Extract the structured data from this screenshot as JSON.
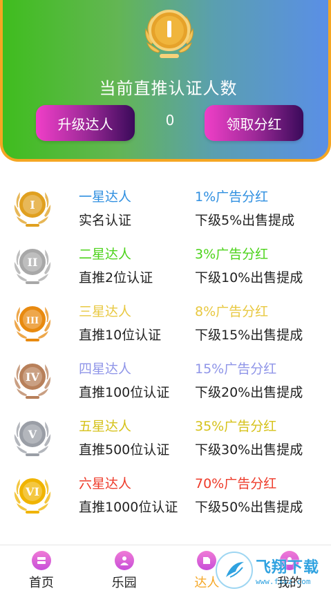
{
  "hero": {
    "title": "当前直推认证人数",
    "count": "0",
    "upgrade_label": "升级达人",
    "claim_label": "领取分红",
    "medal_icon": "gold-medal-icon",
    "gradient": [
      "#3fbd1e",
      "#5a8fe6"
    ],
    "border_color": "#f5a623"
  },
  "levels": [
    {
      "name": "一星达人",
      "requirement": "实名认证",
      "share": "1%广告分红",
      "commission": "下级5%出售提成",
      "color": "#2f8fe0",
      "medal": "gold-medal-i-icon",
      "numeral": "I",
      "medal_color": "#e0a020"
    },
    {
      "name": "二星达人",
      "requirement": "直推2位认证",
      "share": "3%广告分红",
      "commission": "下级10%出售提成",
      "color": "#4cd31a",
      "medal": "silver-medal-ii-icon",
      "numeral": "II",
      "medal_color": "#a8a8a8"
    },
    {
      "name": "三星达人",
      "requirement": "直推10位认证",
      "share": "8%广告分红",
      "commission": "下级15%出售提成",
      "color": "#e8c840",
      "medal": "bronze-medal-iii-icon",
      "numeral": "III",
      "medal_color": "#e88a10"
    },
    {
      "name": "四星达人",
      "requirement": "直推100位认证",
      "share": "15%广告分红",
      "commission": "下级20%出售提成",
      "color": "#8f95e8",
      "medal": "copper-medal-iv-icon",
      "numeral": "IV",
      "medal_color": "#b8805a"
    },
    {
      "name": "五星达人",
      "requirement": "直推500位认证",
      "share": "35%广告分红",
      "commission": "下级30%出售提成",
      "color": "#d6c21a",
      "medal": "platinum-medal-v-icon",
      "numeral": "V",
      "medal_color": "#9a9ea6"
    },
    {
      "name": "六星达人",
      "requirement": "直推1000位认证",
      "share": "70%广告分红",
      "commission": "下级50%出售提成",
      "color": "#ee3b2a",
      "medal": "gold-medal-vi-icon",
      "numeral": "VI",
      "medal_color": "#f0b400"
    }
  ],
  "tabs": [
    {
      "label": "首页",
      "icon": "home-icon",
      "active": false
    },
    {
      "label": "乐园",
      "icon": "paradise-icon",
      "active": false
    },
    {
      "label": "达人",
      "icon": "expert-icon",
      "active": true
    },
    {
      "label": "我的",
      "icon": "profile-icon",
      "active": false
    }
  ],
  "watermark": {
    "main": "飞翔下载",
    "sub": "www.fxxz.com"
  }
}
